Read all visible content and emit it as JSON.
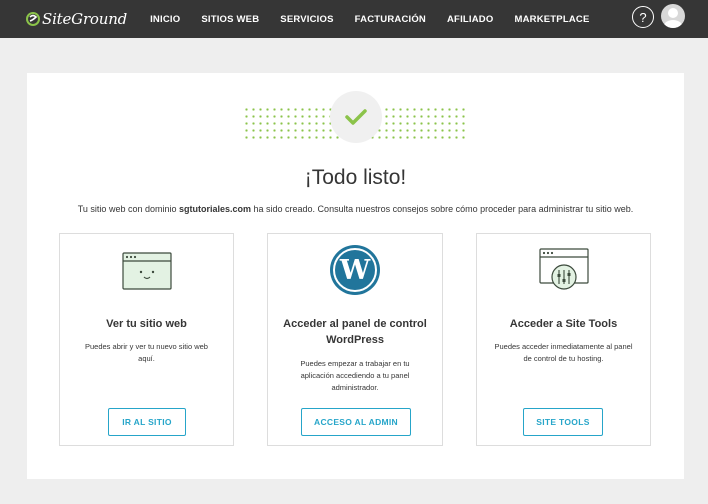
{
  "header": {
    "logo_text": "SiteGround",
    "nav": [
      "INICIO",
      "SITIOS WEB",
      "SERVICIOS",
      "FACTURACIÓN",
      "AFILIADO",
      "MARKETPLACE"
    ],
    "help_icon": "?"
  },
  "main": {
    "title": "¡Todo listo!",
    "subtitle_pre": "Tu sitio web con dominio ",
    "subtitle_domain": "sgtutoriales.com",
    "subtitle_post": " ha sido creado. Consulta nuestros consejos sobre cómo proceder para administrar tu sitio web.",
    "cards": [
      {
        "icon": "browser-smiley-icon",
        "title": "Ver tu sitio web",
        "description": "Puedes abrir y ver tu nuevo sitio web aquí.",
        "button": "IR AL SITIO"
      },
      {
        "icon": "wordpress-icon",
        "title": "Acceder al panel de control WordPress",
        "description": "Puedes empezar a trabajar en tu aplicación accediendo a tu panel administrador.",
        "button": "ACCESO AL ADMIN"
      },
      {
        "icon": "site-tools-icon",
        "title": "Acceder a Site Tools",
        "description": "Puedes acceder inmediatamente al panel de control de tu hosting.",
        "button": "SITE TOOLS"
      }
    ]
  },
  "colors": {
    "topbar": "#363636",
    "accent_green": "#8bc34a",
    "button_blue": "#26a5c9",
    "wordpress_blue": "#21759b"
  }
}
